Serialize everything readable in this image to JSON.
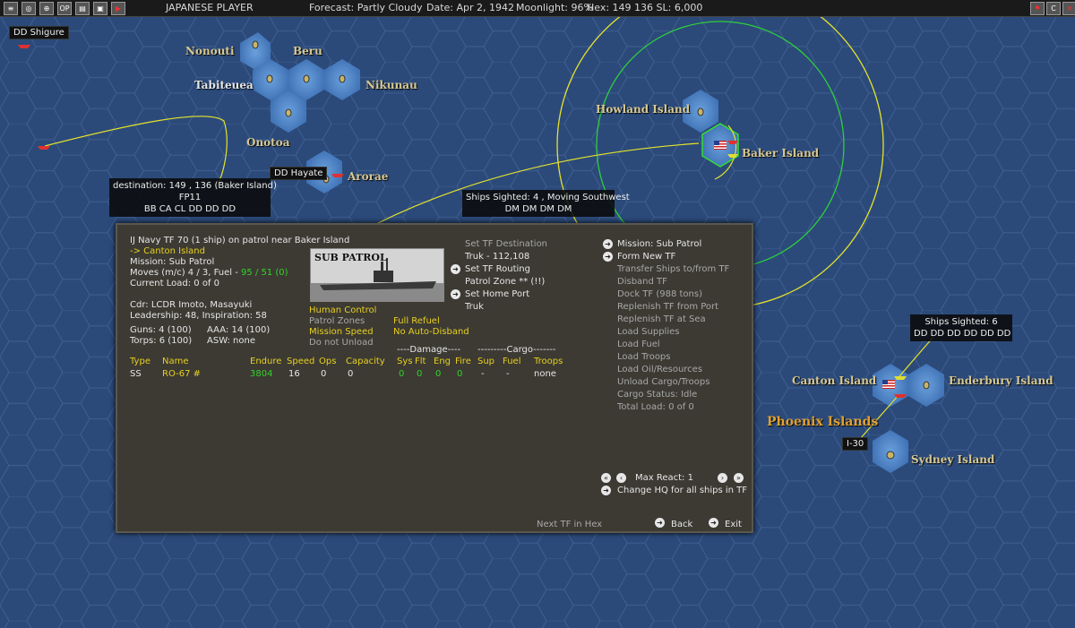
{
  "topbar": {
    "player": "JAPANESE PLAYER",
    "forecast": "Forecast: Partly Cloudy",
    "date": "Date: Apr 2, 1942",
    "moonlight": "Moonlight: 96%",
    "hex": "Hex: 149 136  SL: 6,000",
    "icons": [
      "ships-icon",
      "globe-icon",
      "target-icon",
      "op-icon",
      "report-icon",
      "save-icon",
      "play-icon"
    ],
    "op_label": "OP",
    "right_icons": [
      "flag-icon",
      "c-icon",
      "close-icon"
    ],
    "right_c": "C"
  },
  "map": {
    "labels": {
      "nonouti": "Nonouti",
      "beru": "Beru",
      "tabiteuea": "Tabiteuea",
      "nikunau": "Nikunau",
      "onotoa": "Onotoa",
      "arorae": "Arorae",
      "howland": "Howland Island",
      "baker": "Baker Island",
      "canton": "Canton Island",
      "enderbury": "Enderbury Island",
      "phoenix": "Phoenix Islands",
      "sydney": "Sydney Island"
    },
    "tags": {
      "shigure": "DD Shigure",
      "hayate": "DD Hayate",
      "i30": "I-30"
    },
    "dest_box": {
      "line1": "destination: 149 , 136 (Baker Island)",
      "line2": "FP11",
      "line3": "BB CA CL DD DD DD"
    },
    "sight1": {
      "line1": "Ships Sighted: 4 , Moving Southwest",
      "line2": "DM DM DM DM"
    },
    "sight2": {
      "line1": "Ships Sighted: 6",
      "line2": "DD DD DD DD DD DD"
    }
  },
  "panel": {
    "title": "IJ Navy TF 70 (1 ship)  on patrol near Baker Island",
    "dest": "-> Canton Island",
    "mission": "Mission: Sub Patrol",
    "moves": "Moves (m/c)  4 / 3, Fuel - ",
    "fuel": "95 / 51 (0)",
    "load": "Current Load:  0 of 0",
    "image_title": "SUB PATROL",
    "cdr": "Cdr: LCDR  Imoto, Masayuki",
    "leadership": "Leadership: 48, Inspiration: 58",
    "guns": "Guns: 4 (100)",
    "aaa": "AAA: 14 (100)",
    "torps": "Torps: 6 (100)",
    "asw": "ASW: none",
    "options": {
      "human": "Human Control",
      "patrol": "Patrol Zones",
      "missionspeed": "Mission Speed",
      "unload": "Do not Unload",
      "refuel": "Full Refuel",
      "autodisband": "No Auto-Disband"
    },
    "middle": {
      "set_dest": "Set TF Destination",
      "truk": "Truk - 112,108",
      "set_routing": "Set TF Routing",
      "patrolzone": "Patrol Zone  ** (!!)",
      "set_home": "Set Home Port",
      "home": "Truk"
    },
    "right": {
      "mission": "Mission: Sub Patrol",
      "form": "Form New TF",
      "transfer": "Transfer Ships to/from TF",
      "disband": "Disband TF",
      "dock": "Dock TF (988 tons)",
      "replenish_port": "Replenish TF from Port",
      "replenish_sea": "Replenish TF at Sea",
      "load_supplies": "Load Supplies",
      "load_fuel": "Load Fuel",
      "load_troops": "Load Troops",
      "load_oil": "Load Oil/Resources",
      "unload": "Unload Cargo/Troops",
      "cargo_status": "Cargo Status: Idle",
      "total_load": "Total Load: 0 of 0",
      "max_react": "Max React:  1",
      "change_hq": "Change HQ for all ships in TF"
    },
    "damage_hdr": "----Damage----",
    "cargo_hdr": "---------Cargo-------",
    "columns": [
      "Type",
      "Name",
      "Endure",
      "Speed",
      "Ops",
      "Capacity",
      "Sys",
      "Flt",
      "Eng",
      "Fire",
      "Sup",
      "Fuel",
      "Troops"
    ],
    "row": [
      "SS",
      "RO-67 #",
      "3804",
      "16",
      "0",
      "0",
      "0",
      "0",
      "0",
      "0",
      "-",
      "-",
      "none"
    ],
    "next_tf": "Next TF in Hex",
    "back": "Back",
    "exit": "Exit"
  },
  "colors": {
    "map_bg": "#2b4a7a",
    "panel_bg": "#3c3a33",
    "yellow": "#e8d020",
    "green": "#34d12c"
  }
}
